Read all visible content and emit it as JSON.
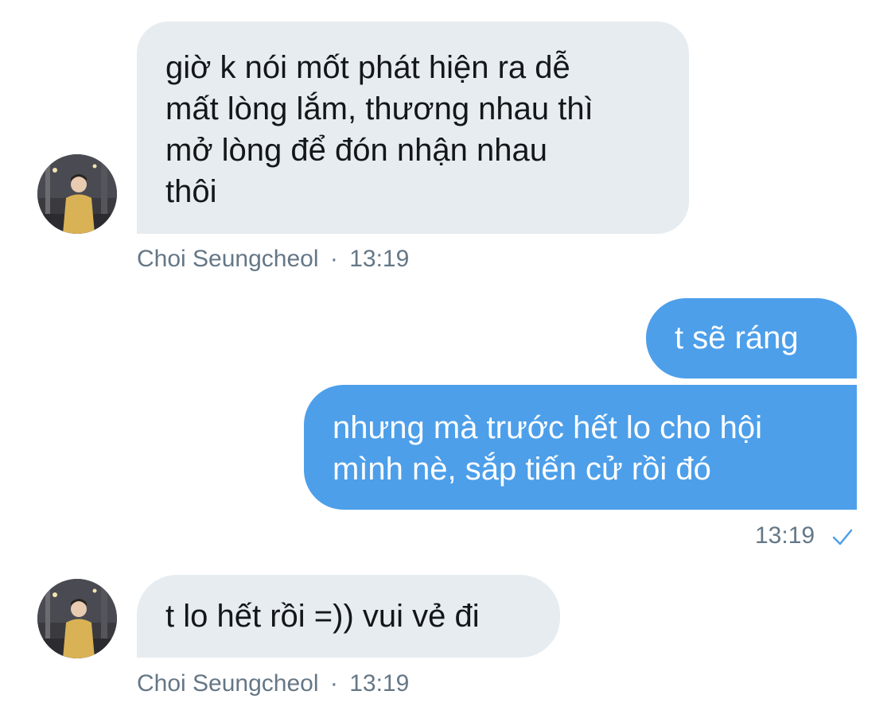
{
  "conversation": {
    "messages": [
      {
        "direction": "received",
        "text": "giờ k nói mốt phát hiện ra dễ\nmất lòng lắm, thương nhau thì\nmở lòng để đón nhận nhau\nthôi",
        "sender": "Choi Seungcheol",
        "separator": "·",
        "time": "13:19"
      },
      {
        "direction": "sent",
        "text": "t sẽ ráng"
      },
      {
        "direction": "sent",
        "text": "nhưng mà trước hết lo cho hội\nmình nè, sắp tiến cử rồi đó",
        "time": "13:19",
        "status_icon": "read-check-icon"
      },
      {
        "direction": "received",
        "text": "t lo hết rồi =)) vui vẻ đi",
        "sender": "Choi Seungcheol",
        "separator": "·",
        "time": "13:19"
      }
    ]
  },
  "colors": {
    "received_bubble": "#e6ecf0",
    "sent_bubble": "#4d9fea",
    "meta_text": "#657786",
    "check": "#4d9fea"
  }
}
